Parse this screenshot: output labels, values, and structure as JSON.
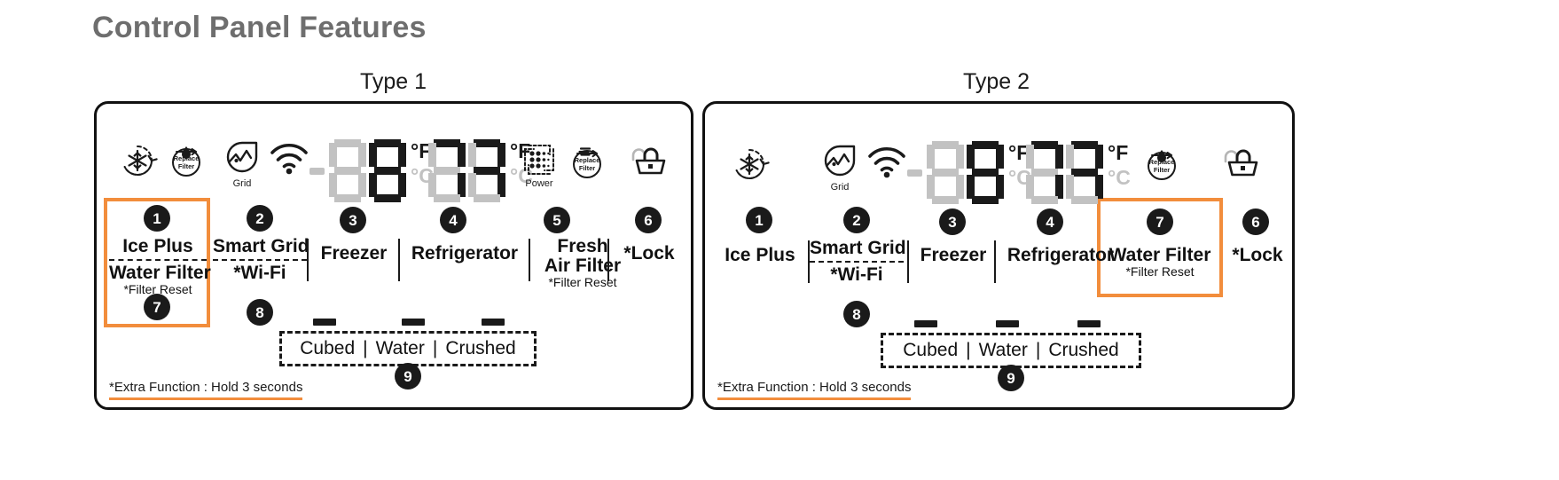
{
  "page": {
    "title": "Control Panel Features",
    "title_color": "#6e6e6e",
    "accent_color": "#f28d3c"
  },
  "panels": [
    {
      "caption": "Type 1",
      "icons": [
        {
          "name": "ice-plus-icon",
          "sublabel": ""
        },
        {
          "name": "replace-filter-icon",
          "line1": "Replace",
          "line2": "Filter",
          "sublabel": ""
        },
        {
          "name": "smart-grid-icon",
          "sublabel": "Grid"
        },
        {
          "name": "wifi-icon",
          "sublabel": ""
        },
        {
          "name": "fresh-air-filter-power-icon",
          "sublabel": "Power"
        },
        {
          "name": "fresh-air-replace-filter-icon",
          "line1": "Replace",
          "line2": "Filter",
          "sublabel": ""
        },
        {
          "name": "lock-icon",
          "sublabel": ""
        }
      ],
      "display": {
        "freezer": {
          "digits": [
            "8",
            "8"
          ],
          "unit_f": "°F",
          "unit_c": "°C",
          "minus": "-"
        },
        "refrigerator": {
          "digits": [
            "8",
            "8"
          ],
          "unit_f": "°F",
          "unit_c": "°C"
        }
      },
      "features": [
        {
          "badge": "1",
          "main": "Ice Plus",
          "sub": "Water Filter",
          "note": "*Filter Reset",
          "badge2": "7",
          "highlight": true
        },
        {
          "badge": "2",
          "main": "Smart Grid",
          "sub": "*Wi-Fi",
          "note": "",
          "badge2": "8",
          "highlight": false
        },
        {
          "badge": "3",
          "main": "Freezer",
          "sub": "",
          "note": "",
          "badge2": "",
          "highlight": false
        },
        {
          "badge": "4",
          "main": "Refrigerator",
          "sub": "",
          "note": "",
          "badge2": "",
          "highlight": false
        },
        {
          "badge": "5",
          "main": "Fresh",
          "main2": "Air Filter",
          "note": "*Filter Reset",
          "badge2": "",
          "highlight": false
        },
        {
          "badge": "6",
          "main": "*Lock",
          "sub": "",
          "note": "",
          "badge2": "",
          "highlight": false
        }
      ],
      "dispenser": {
        "badge": "9",
        "options": [
          "Cubed",
          "Water",
          "Crushed"
        ],
        "separator": "|"
      },
      "footnote": "*Extra Function : Hold 3 seconds"
    },
    {
      "caption": "Type 2",
      "icons": [
        {
          "name": "ice-plus-icon",
          "sublabel": ""
        },
        {
          "name": "smart-grid-icon",
          "sublabel": "Grid"
        },
        {
          "name": "wifi-icon",
          "sublabel": ""
        },
        {
          "name": "replace-filter-icon",
          "line1": "Replace",
          "line2": "Filter",
          "sublabel": ""
        },
        {
          "name": "lock-icon",
          "sublabel": ""
        }
      ],
      "display": {
        "freezer": {
          "digits": [
            "8",
            "8"
          ],
          "unit_f": "°F",
          "unit_c": "°C",
          "minus": "-"
        },
        "refrigerator": {
          "digits": [
            "8",
            "8"
          ],
          "unit_f": "°F",
          "unit_c": "°C"
        }
      },
      "features": [
        {
          "badge": "1",
          "main": "Ice Plus",
          "sub": "",
          "note": "",
          "badge2": "",
          "highlight": false
        },
        {
          "badge": "2",
          "main": "Smart Grid",
          "sub": "*Wi-Fi",
          "note": "",
          "badge2": "8",
          "highlight": false
        },
        {
          "badge": "3",
          "main": "Freezer",
          "sub": "",
          "note": "",
          "badge2": "",
          "highlight": false
        },
        {
          "badge": "4",
          "main": "Refrigerator",
          "sub": "",
          "note": "",
          "badge2": "",
          "highlight": false
        },
        {
          "badge": "7",
          "main": "Water Filter",
          "sub": "",
          "note": "*Filter Reset",
          "badge2": "",
          "highlight": true
        },
        {
          "badge": "6",
          "main": "*Lock",
          "sub": "",
          "note": "",
          "badge2": "",
          "highlight": false
        }
      ],
      "dispenser": {
        "badge": "9",
        "options": [
          "Cubed",
          "Water",
          "Crushed"
        ],
        "separator": "|"
      },
      "footnote": "*Extra Function : Hold 3 seconds"
    }
  ]
}
